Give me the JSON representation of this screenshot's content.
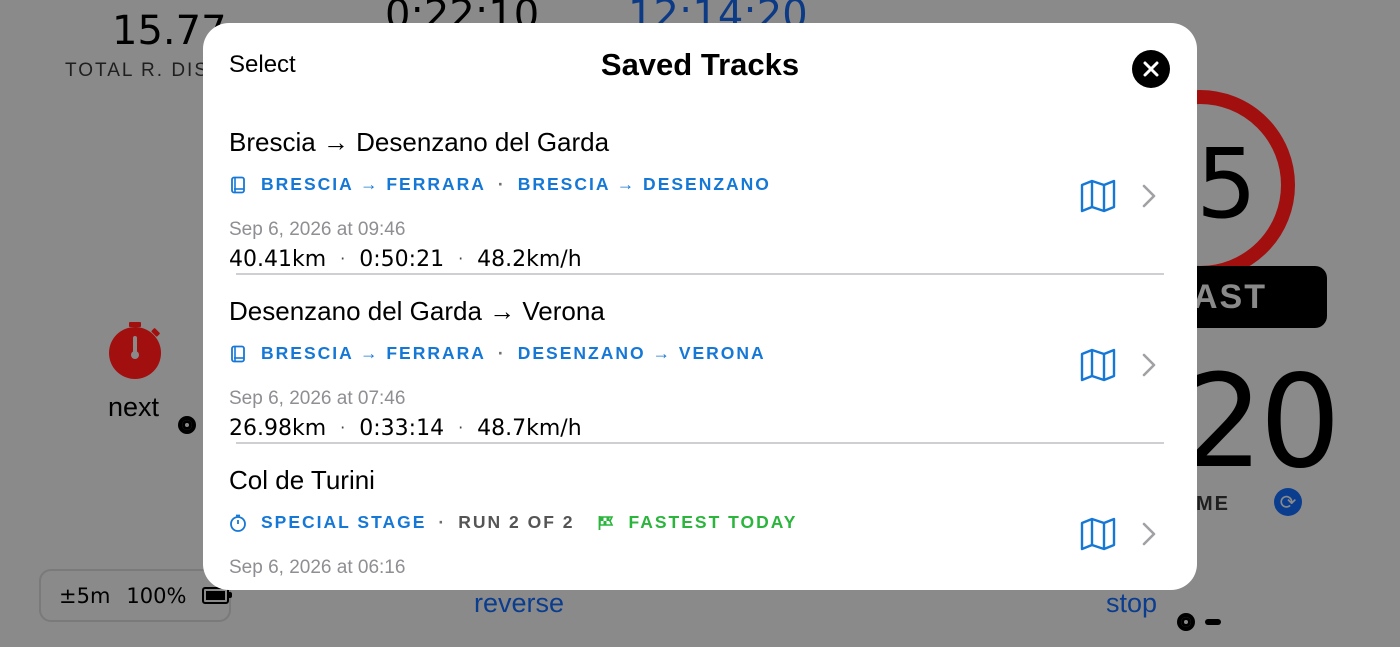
{
  "background": {
    "total_distance_value": "15.77",
    "total_distance_label": "TOTAL R. DIS",
    "time_partial": "0:22:10",
    "clock_partial": "12:14:20",
    "speed_partial": "5",
    "status_partial": "AST",
    "big_number_partial": "20",
    "big_number_label_partial": "ME",
    "next_label": "next",
    "reverse_label": "reverse",
    "stop_label": "stop",
    "gps_accuracy": "±5m",
    "battery_percent": "100%"
  },
  "modal": {
    "select_label": "Select",
    "title": "Saved Tracks",
    "close_icon": "close-icon"
  },
  "tracks": [
    {
      "title": "Brescia → Desenzano del Garda",
      "tag_icon": "book-icon",
      "tag_parts": [
        "BRESCIA → FERRARA",
        "BRESCIA → DESENZANO"
      ],
      "date": "Sep 6, 2026 at 09:46",
      "distance": "40.41km",
      "duration": "0:50:21",
      "avg_speed": "48.2km/h"
    },
    {
      "title": "Desenzano del Garda → Verona",
      "tag_icon": "book-icon",
      "tag_parts": [
        "BRESCIA → FERRARA",
        "DESENZANO → VERONA"
      ],
      "date": "Sep 6, 2026 at 07:46",
      "distance": "26.98km",
      "duration": "0:33:14",
      "avg_speed": "48.7km/h"
    },
    {
      "title": "Col de Turini",
      "tag_icon": "stopwatch-icon",
      "tag_parts": [
        "SPECIAL STAGE",
        "RUN 2 OF 2",
        "FASTEST TODAY"
      ],
      "badge_icon": "flag-icon",
      "date": "Sep 6, 2026 at 06:16"
    }
  ],
  "colors": {
    "accent_blue": "#1678d6",
    "green": "#2bb53d",
    "secondary_text": "#8e8e93",
    "backdrop": "#8a8a8a"
  }
}
